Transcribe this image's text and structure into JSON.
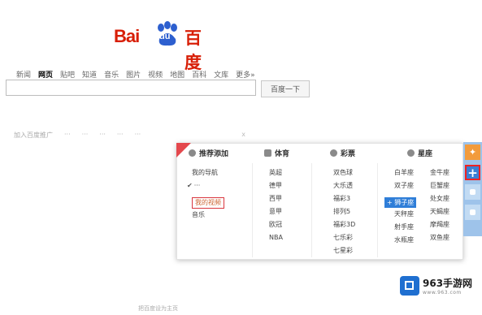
{
  "logo": {
    "latin": "Bai",
    "du": "du",
    "cn": "百度"
  },
  "nav": [
    "新闻",
    "网页",
    "贴吧",
    "知道",
    "音乐",
    "图片",
    "视频",
    "地图",
    "百科",
    "文库",
    "更多»"
  ],
  "nav_active_index": 1,
  "search": {
    "value": "",
    "button": "百度一下"
  },
  "faint_row": [
    "加入百度推广",
    "···",
    "···",
    "···",
    "···",
    "···",
    "x"
  ],
  "panel": {
    "columns": [
      {
        "title": "推荐添加",
        "items": [
          "我的导航",
          "···",
          "我的视频",
          "音乐"
        ]
      },
      {
        "title": "体育",
        "items": [
          "英超",
          "德甲",
          "西甲",
          "意甲",
          "欧冠",
          "NBA"
        ]
      },
      {
        "title": "彩票",
        "items": [
          "双色球",
          "大乐透",
          "福彩3",
          "排列5",
          "福彩3D",
          "七乐彩",
          "七星彩"
        ]
      },
      {
        "title": "星座",
        "items_left": [
          "白羊座",
          "双子座",
          "狮子座",
          "天秤座",
          "射手座",
          "水瓶座"
        ],
        "items_right": [
          "金牛座",
          "巨蟹座",
          "处女座",
          "天蝎座",
          "摩羯座",
          "双鱼座"
        ]
      }
    ],
    "checked_item": "···",
    "boxed_item": "我的视频",
    "selected_item": "狮子座"
  },
  "toolbar": {
    "gift": "gift-icon",
    "add": "+",
    "colors": {
      "gift": "#f29b3c",
      "add": "#3b7fd4",
      "highlight": "#e22222"
    }
  },
  "watermark": {
    "title": "963手游网",
    "sub": "www.963.com"
  },
  "footer": "把百度设为主页"
}
